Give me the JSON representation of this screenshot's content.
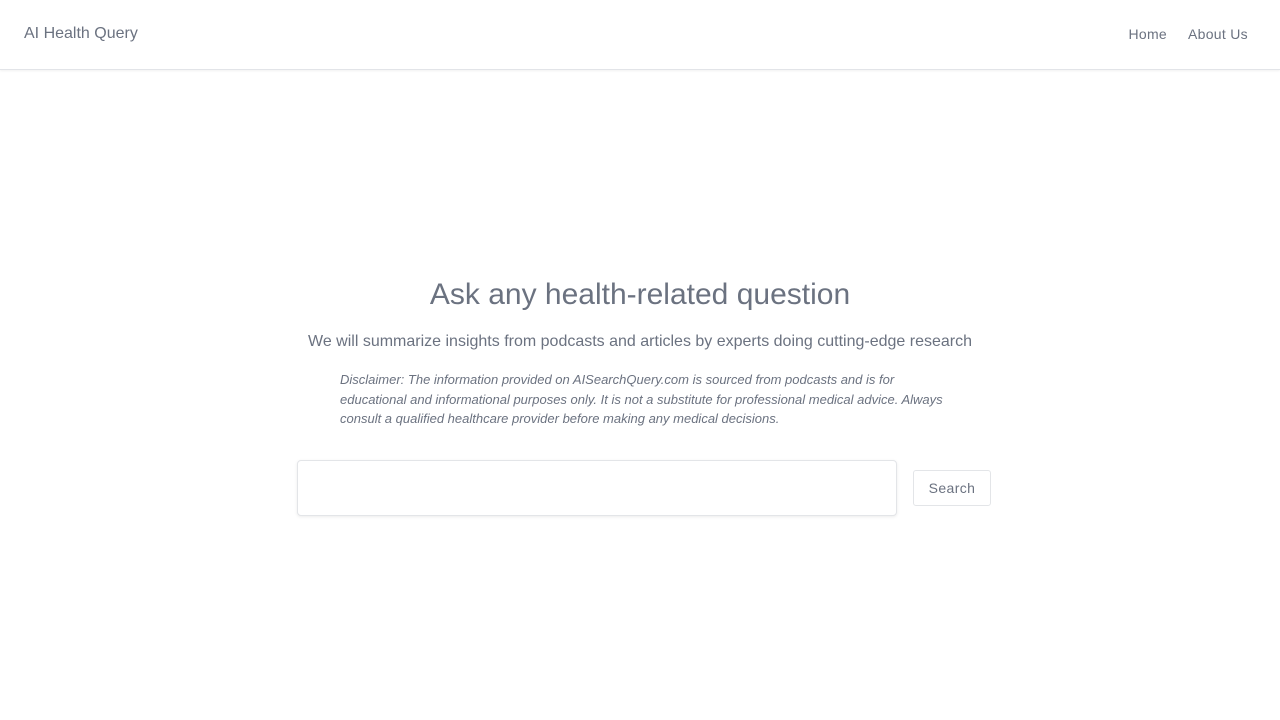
{
  "header": {
    "brand": "AI Health Query",
    "nav": [
      {
        "label": "Home"
      },
      {
        "label": "About Us"
      }
    ]
  },
  "main": {
    "title": "Ask any health-related question",
    "subtitle": "We will summarize insights from podcasts and articles by experts doing cutting-edge research",
    "disclaimer": "Disclaimer: The information provided on AISearchQuery.com is sourced from podcasts and is for educational and informational purposes only. It is not a substitute for professional medical advice. Always consult a qualified healthcare provider before making any medical decisions."
  },
  "search": {
    "value": "",
    "placeholder": "",
    "button_label": "Search"
  },
  "colors": {
    "text": "#6b7280",
    "border": "#e3e5e8",
    "background": "#ffffff"
  }
}
